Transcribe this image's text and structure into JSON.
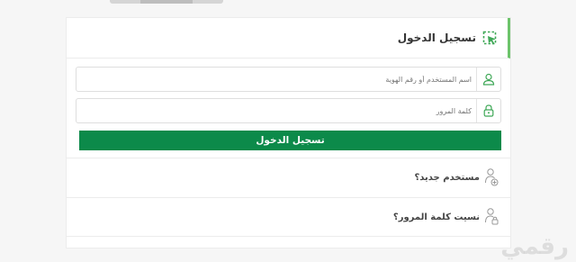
{
  "login": {
    "title": "تسجيل الدخول",
    "username_placeholder": "اسم المستخدم أو رقم الهوية",
    "password_placeholder": "كلمة المرور",
    "submit_label": "تسجيل الدخول"
  },
  "links": {
    "new_user": "مستخدم جديد؟",
    "forgot_password": "نسيت كلمة المرور؟"
  },
  "watermark": "رقمي",
  "icons": {
    "header": "login-pointer-icon",
    "username": "user-icon",
    "password": "lock-icon",
    "new_user": "add-user-icon",
    "forgot": "user-lock-icon"
  },
  "colors": {
    "accent_green": "#0c8a4a",
    "icon_green": "#3fa857",
    "header_border": "#6cc36a"
  }
}
